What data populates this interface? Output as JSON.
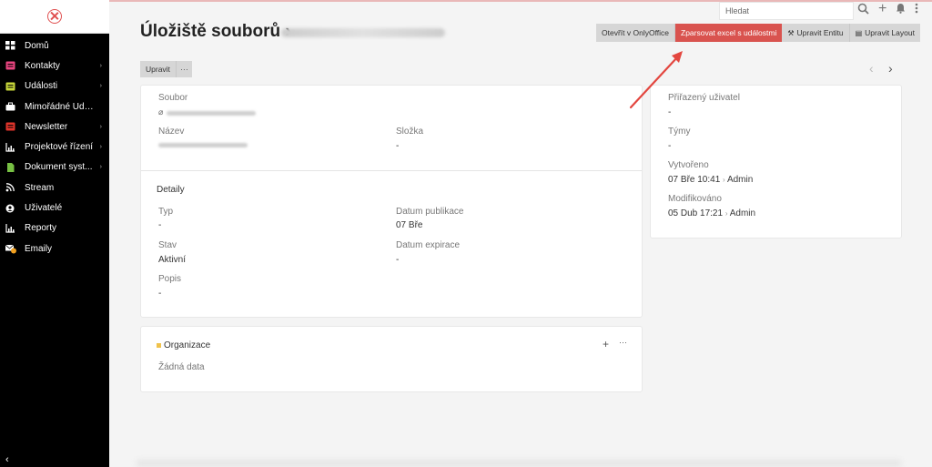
{
  "sidebar": {
    "items": [
      {
        "label": "Domů",
        "icon": "grid-icon",
        "color": "#ffffff",
        "caret": false
      },
      {
        "label": "Kontakty",
        "icon": "contacts-icon",
        "color": "#e8457f",
        "caret": true
      },
      {
        "label": "Události",
        "icon": "events-icon",
        "color": "#c7d63a",
        "caret": true
      },
      {
        "label": "Mimořádné Udál...",
        "icon": "briefcase-icon",
        "color": "#ffffff",
        "caret": false
      },
      {
        "label": "Newsletter",
        "icon": "newsletter-icon",
        "color": "#e0352b",
        "caret": true
      },
      {
        "label": "Projektové řízení",
        "icon": "chart-icon",
        "color": "#ffffff",
        "caret": true
      },
      {
        "label": "Dokument syst...",
        "icon": "document-icon",
        "color": "#77c043",
        "caret": true
      },
      {
        "label": "Stream",
        "icon": "rss-icon",
        "color": "#ffffff",
        "caret": false
      },
      {
        "label": "Uživatelé",
        "icon": "user-icon",
        "color": "#ffffff",
        "caret": false
      },
      {
        "label": "Reporty",
        "icon": "reports-icon",
        "color": "#ffffff",
        "caret": false
      },
      {
        "label": "Emaily",
        "icon": "email-icon",
        "color": "#ffffff",
        "caret": false
      }
    ]
  },
  "topbar": {
    "search_placeholder": "Hledat"
  },
  "header": {
    "title": "Úložiště souborů ›"
  },
  "actions": {
    "open_onlyoffice": "Otevřít v OnlyOffice",
    "parse_excel": "Zparsovat excel s událostmi",
    "edit_entity": "Upravit Entitu",
    "edit_layout": "Upravit Layout"
  },
  "toolbar": {
    "edit_label": "Upravit",
    "more_label": "···"
  },
  "main": {
    "file_label": "Soubor",
    "name_label": "Název",
    "folder_label": "Složka",
    "folder_value": "-",
    "details_title": "Detaily",
    "type_label": "Typ",
    "type_value": "-",
    "pub_label": "Datum publikace",
    "pub_value": "07 Bře",
    "state_label": "Stav",
    "state_value": "Aktivní",
    "exp_label": "Datum expirace",
    "exp_value": "-",
    "desc_label": "Popis",
    "desc_value": "-"
  },
  "org": {
    "title": "Organizace",
    "empty": "Žádná data",
    "dot_color": "#f0c24b"
  },
  "side": {
    "assigned_label": "Přiřazený uživatel",
    "assigned_value": "-",
    "teams_label": "Týmy",
    "teams_value": "-",
    "created_label": "Vytvořeno",
    "created_date": "07 Bře 10:41",
    "created_user": "Admin",
    "modified_label": "Modifikováno",
    "modified_date": "05 Dub 17:21",
    "modified_user": "Admin"
  },
  "colors": {
    "accent": "#d9534f",
    "sidebar_bg": "#000000",
    "arrow": "#e3463f"
  }
}
